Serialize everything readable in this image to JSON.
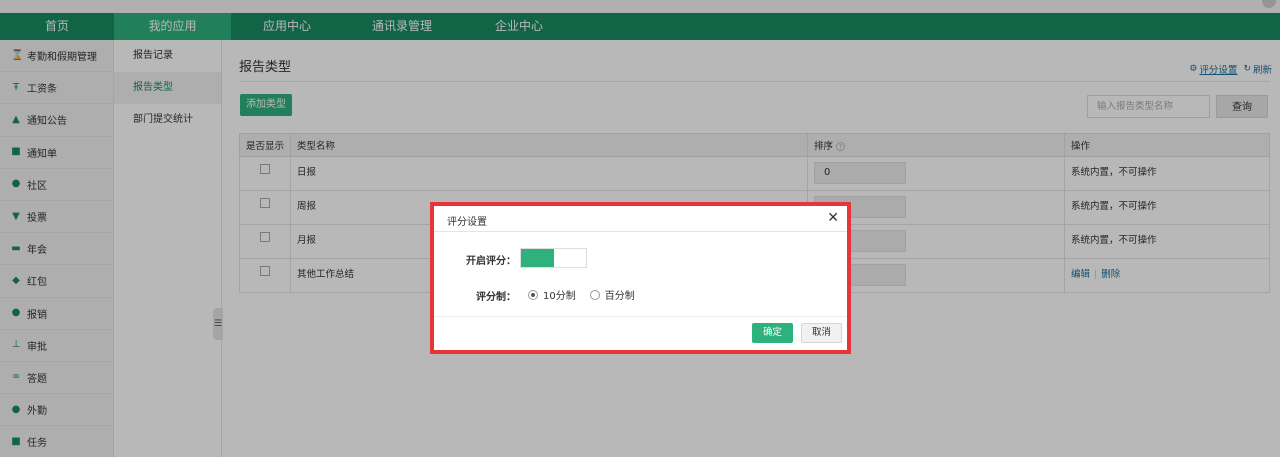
{
  "nav": {
    "items": [
      {
        "label": "首页"
      },
      {
        "label": "我的应用"
      },
      {
        "label": "应用中心"
      },
      {
        "label": "通讯录管理"
      },
      {
        "label": "企业中心"
      }
    ]
  },
  "sidebar": {
    "items": [
      {
        "label": "考勤和假期管理",
        "icon": "hourglass-icon"
      },
      {
        "label": "工资条",
        "icon": "salary-icon"
      },
      {
        "label": "通知公告",
        "icon": "bell-icon"
      },
      {
        "label": "通知单",
        "icon": "notice-icon"
      },
      {
        "label": "社区",
        "icon": "chat-icon"
      },
      {
        "label": "投票",
        "icon": "vote-icon"
      },
      {
        "label": "年会",
        "icon": "annual-meeting-icon"
      },
      {
        "label": "红包",
        "icon": "red-packet-icon"
      },
      {
        "label": "报销",
        "icon": "reimburse-icon"
      },
      {
        "label": "审批",
        "icon": "approval-icon"
      },
      {
        "label": "答题",
        "icon": "quiz-icon"
      },
      {
        "label": "外勤",
        "icon": "location-icon"
      },
      {
        "label": "任务",
        "icon": "task-icon"
      }
    ]
  },
  "submenu": {
    "items": [
      {
        "label": "报告记录"
      },
      {
        "label": "报告类型"
      },
      {
        "label": "部门提交统计"
      }
    ]
  },
  "main": {
    "title": "报告类型",
    "settings_link": "评分设置",
    "refresh_link": "刷新",
    "add_button": "添加类型",
    "search_placeholder": "输入报告类型名称",
    "query_button": "查询",
    "columns": [
      "是否显示",
      "类型名称",
      "排序",
      "操作"
    ],
    "rows": [
      {
        "name": "日报",
        "order": "0",
        "op": "系统内置，不可操作"
      },
      {
        "name": "周报",
        "order": "",
        "op": "系统内置，不可操作"
      },
      {
        "name": "月报",
        "order": "",
        "op": "系统内置，不可操作"
      },
      {
        "name": "其他工作总结",
        "order": "",
        "op_edit": "编辑",
        "op_delete": "删除"
      }
    ]
  },
  "dialog": {
    "title": "评分设置",
    "enable_label": "开启评分：",
    "enable_on": true,
    "scale_label": "评分制：",
    "options": [
      {
        "label": "10分制",
        "checked": true
      },
      {
        "label": "百分制",
        "checked": false
      }
    ],
    "ok_button": "确定",
    "cancel_button": "取消"
  },
  "colors": {
    "nav_bg": "#1a8b63",
    "accent": "#2fb17e",
    "highlight_border": "#e83538",
    "link": "#1a6f9e"
  }
}
